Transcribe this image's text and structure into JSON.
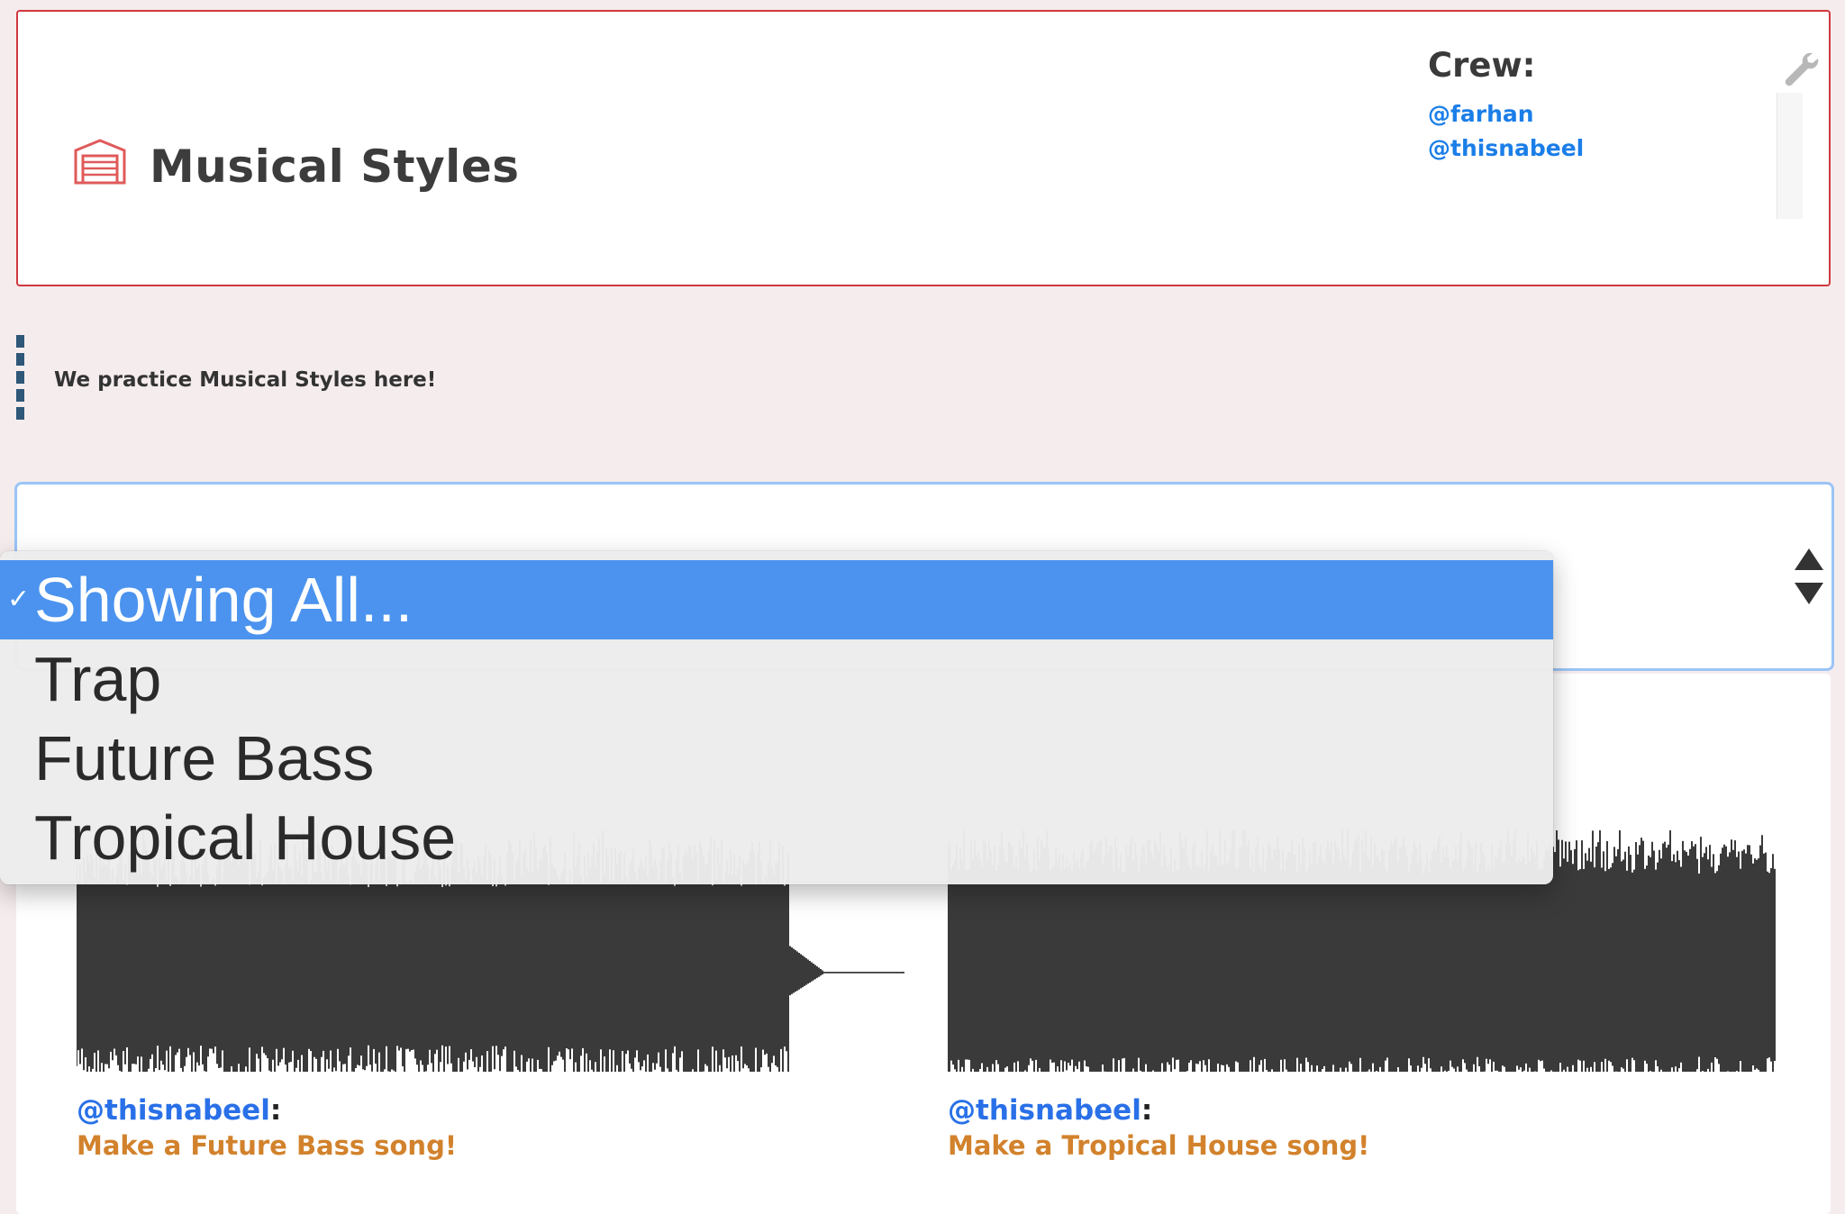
{
  "header": {
    "title": "Musical Styles",
    "crew_title": "Crew:",
    "crew": [
      "@farhan",
      "@thisnabeel"
    ]
  },
  "description": "We practice Musical Styles here!",
  "filter": {
    "options": [
      {
        "label": "Showing All...",
        "selected": true
      },
      {
        "label": "Trap",
        "selected": false
      },
      {
        "label": "Future Bass",
        "selected": false
      },
      {
        "label": "Tropical House",
        "selected": false
      }
    ],
    "check_mark": "✓"
  },
  "tracks": [
    {
      "author": "@thisnabeel",
      "sep": ":",
      "prompt": "Make a Future Bass song!"
    },
    {
      "author": "@thisnabeel",
      "sep": ":",
      "prompt": "Make a Tropical House song!"
    }
  ],
  "colors": {
    "accent_red": "#d0383e",
    "link_blue": "#1b7ee8",
    "prompt_orange": "#d2822c",
    "select_highlight": "#4b93ee",
    "waveform": "#3a3a3a"
  }
}
